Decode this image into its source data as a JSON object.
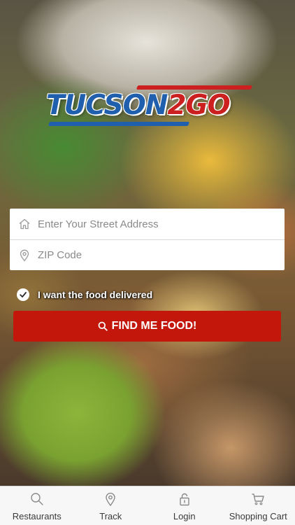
{
  "logo": {
    "main": "TUCSON",
    "accent": "2GO",
    "colors": {
      "blue": "#1f5fae",
      "red": "#cc1f1f"
    }
  },
  "form": {
    "street": {
      "placeholder": "Enter Your Street Address",
      "value": "",
      "icon": "home-icon"
    },
    "zip": {
      "placeholder": "ZIP Code",
      "value": "",
      "icon": "map-pin-icon"
    }
  },
  "delivery": {
    "label": "I want the food delivered",
    "checked": true,
    "icon": "check-circle-icon"
  },
  "find_button": {
    "label": "FIND ME FOOD!",
    "icon": "search-icon",
    "color": "#c4170c"
  },
  "tabbar": {
    "items": [
      {
        "label": "Restaurants",
        "icon": "search-icon"
      },
      {
        "label": "Track",
        "icon": "map-pin-icon"
      },
      {
        "label": "Login",
        "icon": "unlock-icon"
      },
      {
        "label": "Shopping Cart",
        "icon": "cart-icon"
      }
    ]
  }
}
